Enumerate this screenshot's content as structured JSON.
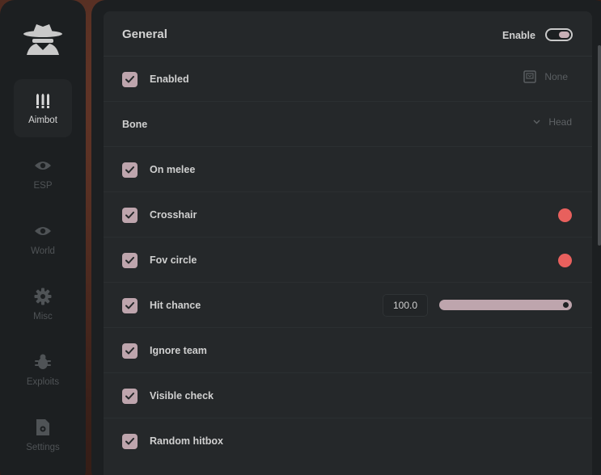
{
  "sidebar": {
    "logo_icon": "spy-icon",
    "items": [
      {
        "label": "Aimbot",
        "icon": "bullets-icon",
        "active": true
      },
      {
        "label": "ESP",
        "icon": "eye-icon",
        "active": false
      },
      {
        "label": "World",
        "icon": "eye-icon",
        "active": false
      },
      {
        "label": "Misc",
        "icon": "gear-icon",
        "active": false
      },
      {
        "label": "Exploits",
        "icon": "bug-icon",
        "active": false
      },
      {
        "label": "Settings",
        "icon": "file-gear-icon",
        "active": false
      }
    ]
  },
  "panel": {
    "title": "General",
    "enable_label": "Enable",
    "enable_on": true,
    "rows": [
      {
        "label": "Enabled",
        "checked": true,
        "keybind": "None"
      },
      {
        "label": "Bone",
        "dropdown_value": "Head"
      },
      {
        "label": "On melee",
        "checked": true
      },
      {
        "label": "Crosshair",
        "checked": true,
        "color": "#e8605d"
      },
      {
        "label": "Fov circle",
        "checked": true,
        "color": "#e8605d"
      },
      {
        "label": "Hit chance",
        "checked": true,
        "value": "100.0",
        "slider_fraction": 1.0
      },
      {
        "label": "Ignore team",
        "checked": true
      },
      {
        "label": "Visible check",
        "checked": true
      },
      {
        "label": "Random hitbox",
        "checked": true
      }
    ]
  },
  "colors": {
    "accent": "#bea5ad",
    "crosshair": "#e8605d"
  }
}
